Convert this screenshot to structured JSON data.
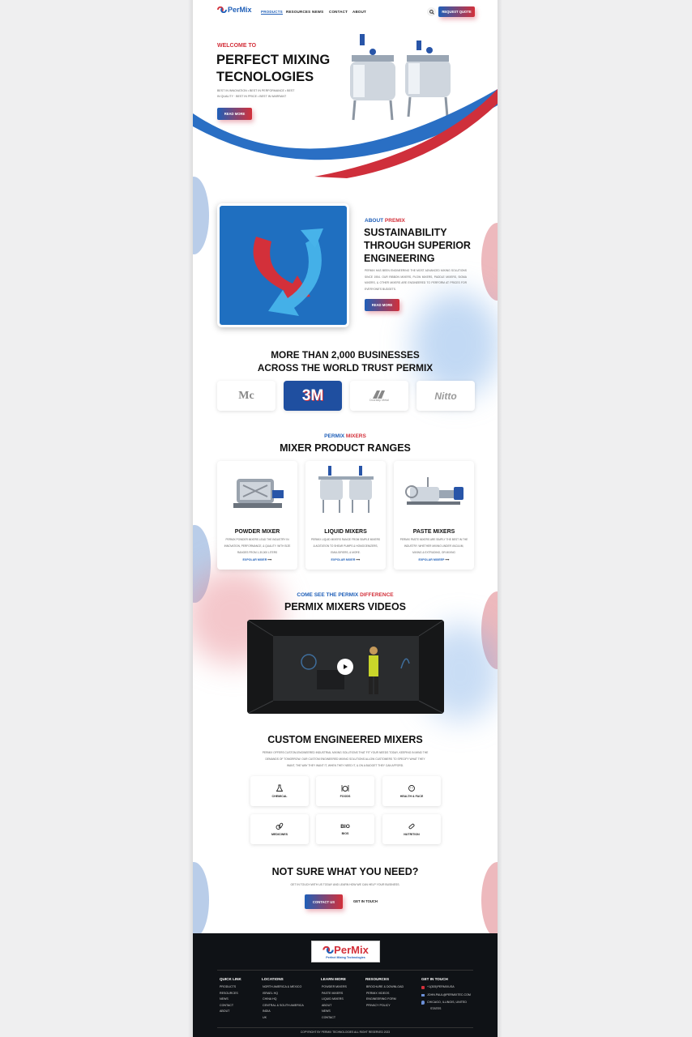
{
  "header": {
    "logo": "PerMix",
    "nav": [
      "PRODUCTS",
      "RESOURCES",
      "NEWS",
      "CONTACT",
      "ABOUT"
    ],
    "cta": "REQUEST QUOTE"
  },
  "hero": {
    "eyebrow": "WELCOME TO",
    "title_line1": "PERFECT MIXING",
    "title_line2": "TECNOLOGIES",
    "tagline_line1": "BEST IN INNOVATION • BEST IN PERFORMANCE • BEST",
    "tagline_line2": "IN QUALITY · BEST IN PRICE • BEST IN WARRANT",
    "button": "READ MORE"
  },
  "about": {
    "eyebrow_a": "ABOUT",
    "eyebrow_b": "PREMIX",
    "title_line1": "SUSTAINABILITY",
    "title_line2": "THROUGH SUPERIOR",
    "title_line3": "ENGINEERING",
    "body": "PERMIX HAS BEEN ENGINEERING THE MOST ADVANCED MIXING SOLUTIONS SINCE 1954. OUR RIBBON MIXERS, PLOW MIXERS, PADDLE MIXERS, SIGMA MIXERS, & OTHER MIXERS ARE ENGINEERED TO PERFORM AT PRICES FOR EVERYONE'S BUDGETS.",
    "button": "READ MORE"
  },
  "trust": {
    "title_line1": "MORE THAN 2,000 BUSINESSES",
    "title_line2": "ACROSS THE WORLD TRUST PERMIX",
    "logos": [
      "Mc",
      "3M",
      "Doorstep Metal",
      "Nitto"
    ]
  },
  "products": {
    "eyebrow_a": "PERMIX",
    "eyebrow_b": "MIXERS",
    "title": "MIXER PRODUCT RANGES",
    "items": [
      {
        "name": "POWDER MIXER",
        "desc": "PERMIX POWDER MIXERS LEAD THE INDUSTRY IN INNOVATION, PERFORMANCE, & QUALITY. WITH SIZE RANGES FROM 1-30,000 LITERS",
        "link": "EXPOLAR MIXER"
      },
      {
        "name": "LIQUID MIXERS",
        "desc": "PERMIX LIQUID MIXERS RANGE FROM SIMPLE MIXERS & AGITATION TO SHEAR PUMPS & HOMOGENIZERS, EMULSIFIERS, & MORE.",
        "link": "EXPOLAR MIXER"
      },
      {
        "name": "PASTE MIXERS",
        "desc": "PERMIX PASTE MIXERS ARE SIMPLY THE BEST IN THE INDUSTRY. WHETHER MIXING UNDER VACUUM, MIXING & EXTRUDING, OR MIXING",
        "link": "EXPOLAR MIXEEP"
      }
    ]
  },
  "videos": {
    "eyebrow_a": "COME SEE THE PERMIX",
    "eyebrow_b": "DIFFERENCE",
    "title": "PERMIX MIXERS VIDEOS"
  },
  "custom": {
    "title": "CUSTOM ENGINEERED MIXERS",
    "body_line1": "PERMIX OFFERS CUSTOM-ENGINEERED INDUSTRIAL MIXING SOLUTIONS THAT FIT YOUR NEEDS TODAY, KEEPING IN MIND THE",
    "body_line2": "DEMANDS OF TOMORROW. OUR CUSTOM ENGINEERED MIXING SOLUTIONS ALLOW CUSTOMERS TO SPECIFY WHAT THEY",
    "body_line3": "WANT, THE WAY THEY WANT IT, WHEN THEY NEED IT, & ON A BUDGET THEY CAN AFFORD.",
    "industries": [
      "CHEMICAL",
      "FOODS",
      "HEALTH & FACE",
      "MEDICINES",
      "BIOS",
      "NUTRITION"
    ],
    "bio_glyph": "BIO"
  },
  "cta": {
    "title": "NOT SURE WHAT YOU NEED?",
    "body": "GET IN TOUCH WITH US TODAY AND LEARN HOW WE CAN HELP YOUR BUSINESS.",
    "primary": "CONTACT US",
    "secondary": "GET IN TOUCH"
  },
  "footer": {
    "logo": "PerMix",
    "logo_sub": "Perfect Mixing Technologies",
    "columns": [
      {
        "title": "QUICK LINK",
        "items": [
          "PRODUCTS",
          "RESOURCES",
          "NEWS",
          "CONTACT",
          "ABOUT"
        ]
      },
      {
        "title": "LOCATIONS",
        "items": [
          "NORTH AMERICA & MEXICO",
          "ISRAEL HQ",
          "CHINA HQ",
          "CENTRAL & SOUTH AMERICA",
          "INDIA",
          "UK"
        ]
      },
      {
        "title": "LEARN MORE",
        "items": [
          "POWDER MIXERS",
          "PASTE MIXERS",
          "LIQUID MIXERS",
          "ABOUT",
          "NEWS",
          "CONTACT"
        ]
      },
      {
        "title": "RESOURCES",
        "items": [
          "BROCHURE & DOWNLOAD",
          "PERMIX VIDEOS",
          "ENGINEERING FORM",
          "PRIVACY POLICY"
        ]
      }
    ],
    "contact_title": "GET IN TOUCH",
    "phone": "+1(305)PERMIXUSA",
    "email": "JOHN.PAUL@PERMIXTEC.COM",
    "address_line1": "CHICAGO, ILLINOIS, UNITED",
    "address_line2": "STATES",
    "copyright": "COPYRIGHT BY PERMIX TECHNOLOGIES ALL RIGHT RESERVED 2023"
  },
  "colors": {
    "blue": "#1f5fb8",
    "red": "#d3303a",
    "dark": "#0f1216"
  }
}
